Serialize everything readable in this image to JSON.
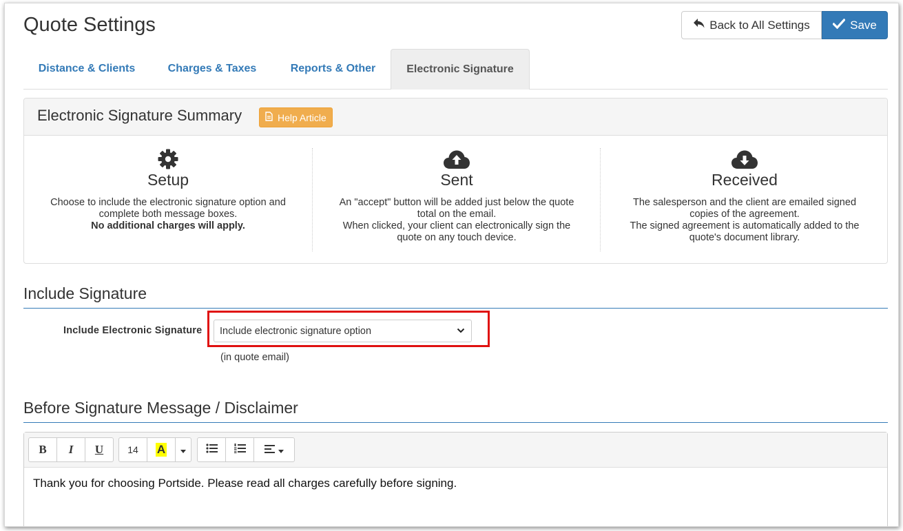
{
  "header": {
    "title": "Quote Settings",
    "back_label": "Back to All Settings",
    "save_label": "Save"
  },
  "tabs": [
    {
      "label": "Distance & Clients",
      "active": false
    },
    {
      "label": "Charges & Taxes",
      "active": false
    },
    {
      "label": "Reports & Other",
      "active": false
    },
    {
      "label": "Electronic Signature",
      "active": true
    }
  ],
  "summary": {
    "title": "Electronic Signature Summary",
    "help_label": "Help Article",
    "columns": [
      {
        "icon": "gear-icon",
        "title": "Setup",
        "lines": [
          "Choose to include the electronic signature option and complete both message boxes."
        ],
        "bold": "No additional charges will apply."
      },
      {
        "icon": "cloud-upload-icon",
        "title": "Sent",
        "lines": [
          "An \"accept\" button will be added just below the quote total on the email.",
          "When clicked, your client can electronically sign the quote on any touch device."
        ]
      },
      {
        "icon": "cloud-download-icon",
        "title": "Received",
        "lines": [
          "The salesperson and the client are emailed signed copies of the agreement.",
          "The signed agreement is automatically added to the quote's document library."
        ]
      }
    ]
  },
  "include_section": {
    "title": "Include Signature",
    "field_label": "Include Electronic Signature",
    "select_value": "Include electronic signature option",
    "help_text": "(in quote email)"
  },
  "disclaimer_section": {
    "title": "Before Signature Message / Disclaimer",
    "toolbar": {
      "bold": "B",
      "italic": "I",
      "underline": "U",
      "font_size": "14",
      "highlight": "A"
    },
    "body_text": "Thank you for choosing Portside. Please read all charges carefully before signing."
  },
  "colors": {
    "link": "#337ab7",
    "primary": "#337ab7",
    "warning": "#f0ad4e",
    "highlight_border": "#e0100f"
  }
}
